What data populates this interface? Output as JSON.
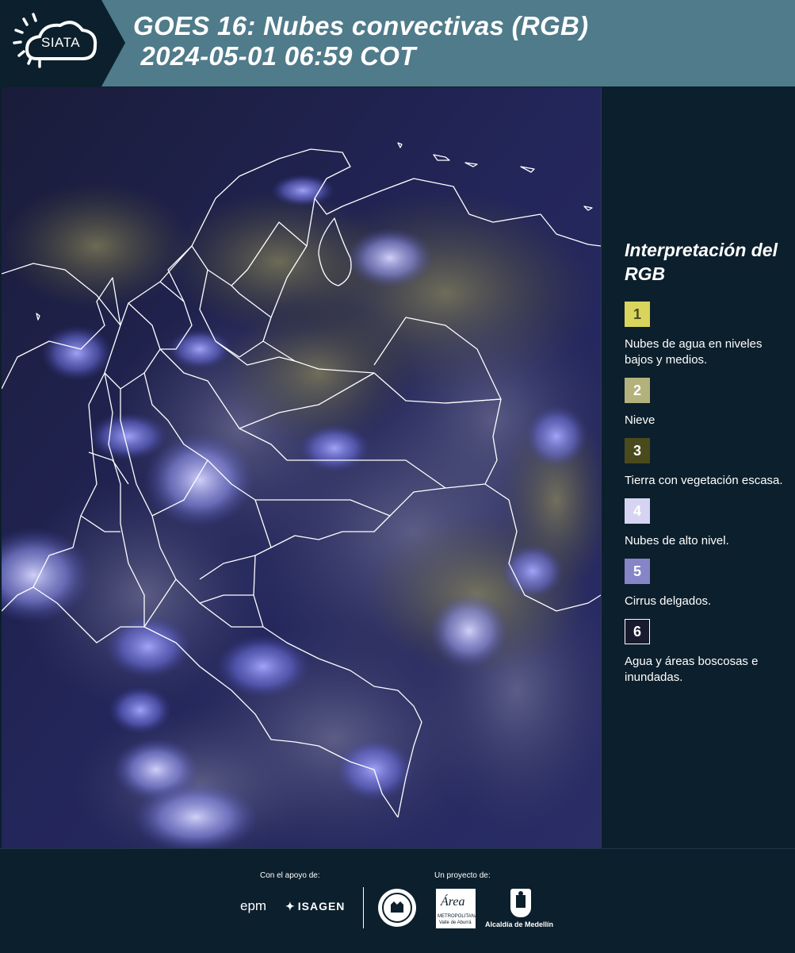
{
  "header": {
    "logo_text": "SIATA",
    "title_line1": "GOES 16: Nubes convectivas (RGB)",
    "title_line2": " 2024-05-01 06:59 COT"
  },
  "map": {
    "description_colors": {
      "background": "#1b1f4a",
      "borders": "#ffffff",
      "high_clouds": "#8a8cf0",
      "low_clouds": "#8f8a5a"
    }
  },
  "legend": {
    "title": "Interpretación del RGB",
    "items": [
      {
        "number": "1",
        "label": "Nubes de agua en niveles bajos y medios.",
        "color": "#d9d45c",
        "text_color": "#4a4a1a"
      },
      {
        "number": "2",
        "label": "Nieve",
        "color": "#b3b17c",
        "text_color": "#ffffff"
      },
      {
        "number": "3",
        "label": "Tierra con vegetación escasa.",
        "color": "#4a4a1c",
        "text_color": "#ffffff"
      },
      {
        "number": "4",
        "label": "Nubes de alto nivel.",
        "color": "#d6d4f2",
        "text_color": "#ffffff"
      },
      {
        "number": "5",
        "label": "Cirrus delgados.",
        "color": "#8585c8",
        "text_color": "#ffffff"
      },
      {
        "number": "6",
        "label": "Agua y áreas boscosas e inundadas.",
        "color": "#1a1a2e",
        "text_color": "#ffffff",
        "border": "#ffffff"
      }
    ]
  },
  "footer": {
    "support_caption": "Con el apoyo de:",
    "project_caption": "Un proyecto de:",
    "sponsor_epm": "epm",
    "sponsor_isagen": "ISAGEN",
    "area_metro": "Área",
    "area_metro_sub": "METROPOLITANA",
    "area_metro_sub2": "Valle de Aburrá",
    "alcaldia": "Alcaldía de Medellín"
  }
}
